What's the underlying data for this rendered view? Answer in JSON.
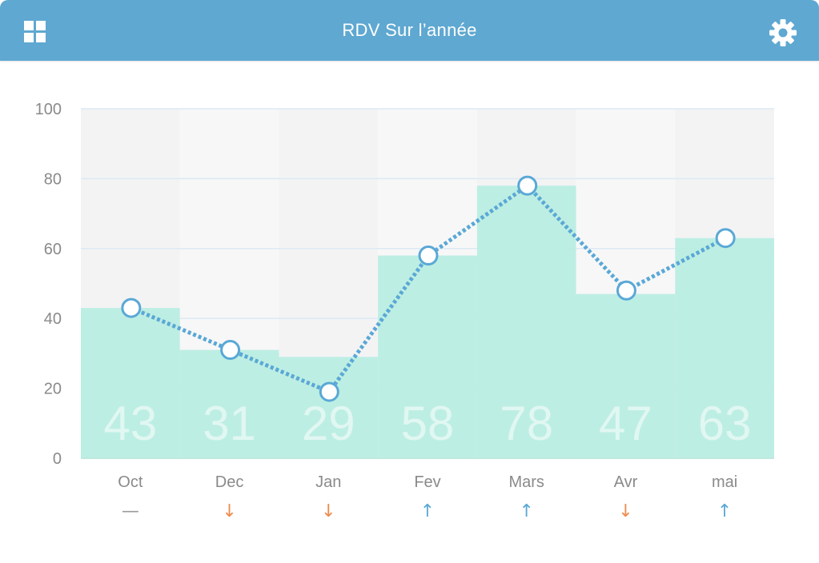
{
  "header": {
    "title": "RDV Sur l’année",
    "left_icon": "grid-icon",
    "right_icon": "gear-icon"
  },
  "colors": {
    "header": "#5ea8d1",
    "bar": "#b9ede1",
    "line": "#5aa8d6",
    "trend_up": "#5aa8d6",
    "trend_down": "#ee8c4e",
    "trend_flat": "#9a9a9a"
  },
  "chart_data": {
    "type": "bar",
    "overlay": "line",
    "categories": [
      "Oct",
      "Dec",
      "Jan",
      "Fev",
      "Mars",
      "Avr",
      "mai"
    ],
    "values": [
      43,
      31,
      29,
      58,
      78,
      47,
      63
    ],
    "line_values": [
      43,
      31,
      19,
      58,
      78,
      48,
      63
    ],
    "yticks": [
      0,
      20,
      40,
      60,
      80,
      100
    ],
    "ylim": [
      0,
      100
    ],
    "grid": true,
    "trends": [
      "flat",
      "down",
      "down",
      "up",
      "up",
      "down",
      "up"
    ],
    "trend_glyphs": [
      "—",
      "↓",
      "↓",
      "↑",
      "↑",
      "↓",
      "↑"
    ]
  }
}
